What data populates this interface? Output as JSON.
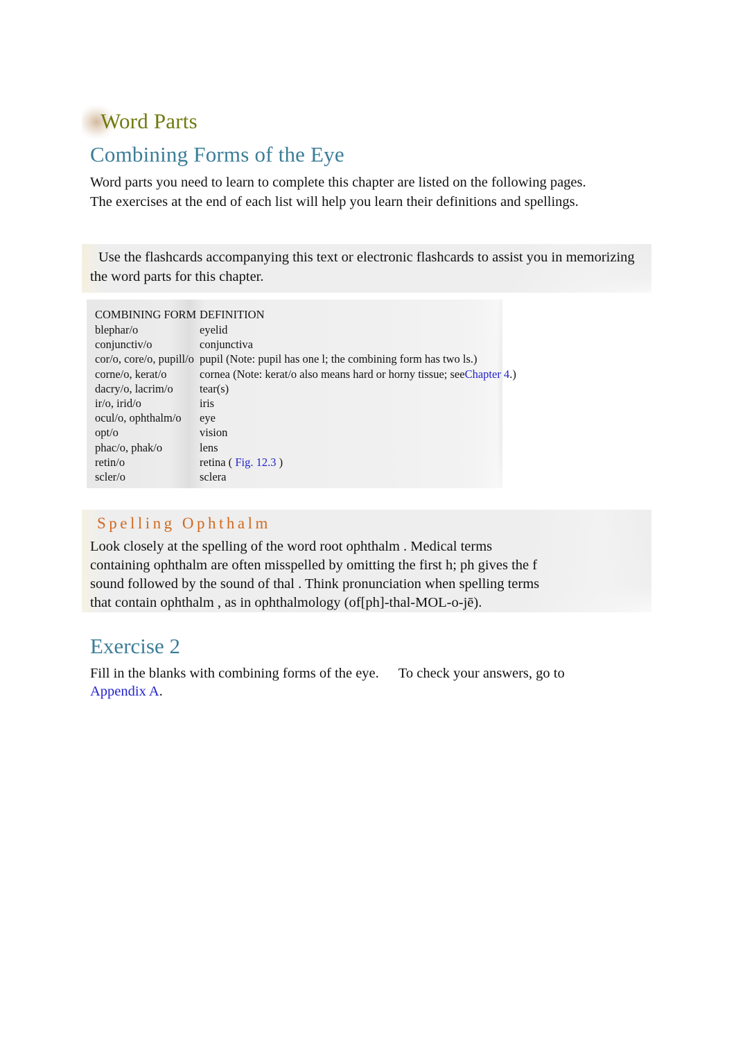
{
  "document": {
    "section_label": "Word Parts",
    "heading": "Combining Forms of the Eye",
    "intro_paragraph": "Word parts you need to learn to complete this chapter are listed on the following pages. The exercises at the end of each list will help you learn their definitions and spellings."
  },
  "flashcard_callout": {
    "line1": "Use the flashcards accompanying this text or electronic flashcards to assist",
    "line2": "you in memorizing the word parts for this chapter."
  },
  "table": {
    "header": {
      "col1": "COMBINING FORM",
      "col2": "DEFINITION"
    },
    "rows": [
      {
        "form": "blephar/o",
        "definition": "eyelid"
      },
      {
        "form": "conjunctiv/o",
        "definition": "conjunctiva"
      },
      {
        "form": "cor/o, core/o, pupill/o",
        "definition": "pupil   (Note: pupil has one l; the combining form has two ls.)"
      },
      {
        "form": "corne/o, kerat/o",
        "definition_pre": "cornea   (Note: kerat/o also means hard  or horny tissue;    see",
        "definition_link": "Chapter 4",
        "definition_post": ".)"
      },
      {
        "form": "dacry/o, lacrim/o",
        "definition": "tear(s)"
      },
      {
        "form": "ir/o, irid/o",
        "definition": "iris"
      },
      {
        "form": "ocul/o, ophthalm/o",
        "definition": "eye"
      },
      {
        "form": "opt/o",
        "definition": "vision"
      },
      {
        "form": "phac/o, phak/o",
        "definition": "lens"
      },
      {
        "form": "retin/o",
        "definition_pre": "retina ( ",
        "definition_link": "Fig. 12.3",
        "definition_post": " )"
      },
      {
        "form": "scler/o",
        "definition": "sclera"
      }
    ]
  },
  "spelling_callout": {
    "title": "Spelling  Ophthalm",
    "line1": "Look closely at the spelling of the word root        ophthalm   . Medical terms",
    "line2": "containing   ophthalm    are often misspelled by omitting the first h;        ph  gives the  f",
    "line3": "sound followed by the sound of        thal . Think pronunciation when spelling terms",
    "line4": "that contain    ophthalm   , as in ophthalmology (of[ph]-thal-MOL-o-jē)."
  },
  "exercise": {
    "title": "Exercise 2",
    "line1_a": "Fill in the blanks with combining forms of the eye.",
    "line1_b": "To check your answers, go to",
    "line2_link": "Appendix A",
    "line2_post": "."
  },
  "colors": {
    "word_parts_green": "#707B0E",
    "heading_teal": "#3B7D98",
    "spelling_orange": "#D2691E",
    "link_blue": "#2222CC",
    "callout_gray": "#EEEEEE"
  }
}
